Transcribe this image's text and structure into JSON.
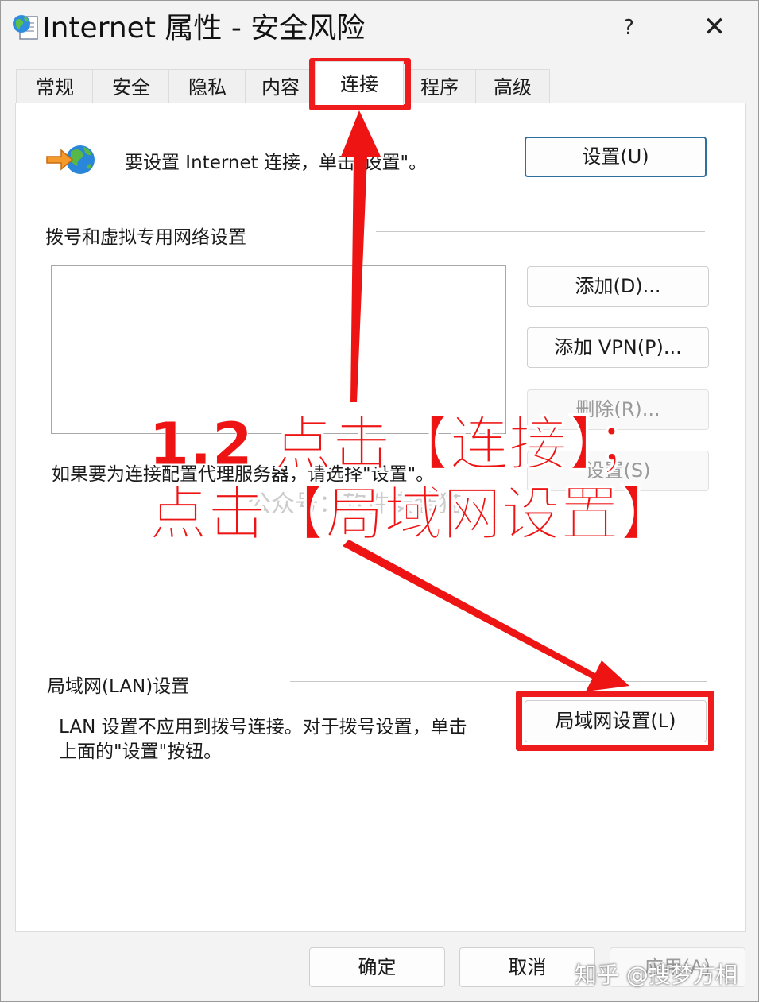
{
  "window": {
    "title": "Internet 属性 - 安全风险",
    "help": "?",
    "close": "✕"
  },
  "tabs": [
    {
      "label": "常规"
    },
    {
      "label": "安全"
    },
    {
      "label": "隐私"
    },
    {
      "label": "内容"
    },
    {
      "label": "连接"
    },
    {
      "label": "程序"
    },
    {
      "label": "高级"
    }
  ],
  "connection": {
    "setup_text": "要设置 Internet 连接，单击\"设置\"。",
    "setup_button": "设置(U)",
    "dialup_section": "拨号和虚拟专用网络设置",
    "add_button": "添加(D)...",
    "add_vpn_button": "添加 VPN(P)...",
    "remove_button": "删除(R)...",
    "settings_button": "设置(S)",
    "proxy_text": "如果要为连接配置代理服务器，请选择\"设置\"。",
    "lan_section": "局域网(LAN)设置",
    "lan_text_line1": "LAN 设置不应用到拨号连接。对于拨号设置，单击",
    "lan_text_line2": "上面的\"设置\"按钮。",
    "lan_button": "局域网设置(L)"
  },
  "footer": {
    "ok": "确定",
    "cancel": "取消",
    "apply": "应用(A)"
  },
  "annotation": {
    "line1": "1.2 点击【连接】；",
    "line2": "点击【局域网设置】",
    "color": "#ee1414"
  },
  "watermarks": {
    "center": "公众号：软件安装猫",
    "corner": "知乎 @搜梦方相"
  },
  "icons": {
    "title_icon": "internet-options-icon",
    "setup_icon": "connect-globe-icon"
  }
}
